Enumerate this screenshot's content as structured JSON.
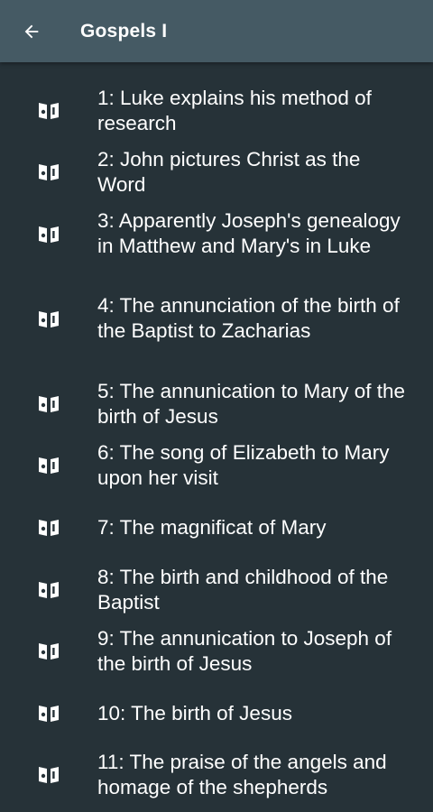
{
  "appbar": {
    "title": "Gospels I",
    "back_icon": "arrow-back-icon"
  },
  "list": {
    "item_icon": "book-reader-icon",
    "items": [
      {
        "label": "1: Luke explains his method of research"
      },
      {
        "label": "2: John pictures Christ as the Word"
      },
      {
        "label": "3: Apparently Joseph's genealogy in Matthew and Mary's in Luke"
      },
      {
        "label": "4: The annunciation of the birth of the Baptist to Zacharias"
      },
      {
        "label": "5: The annunication to Mary of the birth of Jesus"
      },
      {
        "label": "6: The song of Elizabeth to Mary upon her visit"
      },
      {
        "label": "7: The magnificat of Mary"
      },
      {
        "label": "8: The birth and childhood of the Baptist"
      },
      {
        "label": "9: The annunication to Joseph of the birth of Jesus"
      },
      {
        "label": "10: The birth of Jesus"
      },
      {
        "label": "11: The praise of the angels and homage of the shepherds"
      }
    ]
  },
  "colors": {
    "appbar": "#455a64",
    "background": "#263238",
    "text": "#ffffff"
  }
}
